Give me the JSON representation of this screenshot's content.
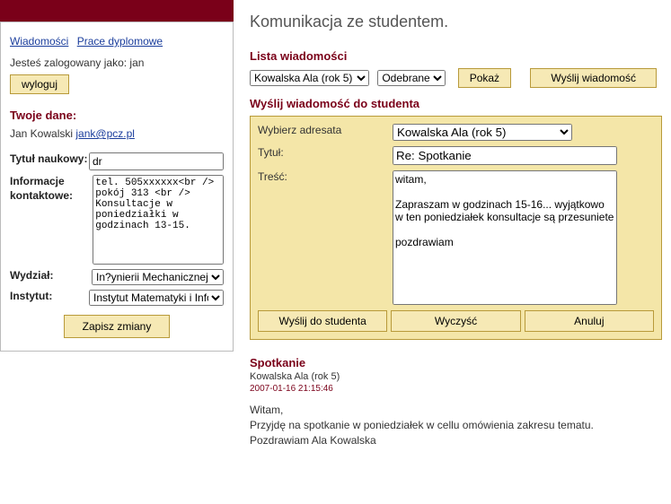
{
  "sidebar": {
    "links": {
      "wiadomosci": "Wiadomości",
      "prace": "Prace dyplomowe"
    },
    "logged_as_prefix": "Jesteś zalogowany jako: ",
    "logged_as_user": "jan",
    "logout": "wyloguj",
    "twoje_dane": "Twoje dane:",
    "name": "Jan Kowalski",
    "email": "jank@pcz.pl",
    "labels": {
      "tytul": "Tytuł naukowy:",
      "kontakt": "Informacje kontaktowe:",
      "wydzial": "Wydział:",
      "instytut": "Instytut:"
    },
    "values": {
      "tytul": "dr",
      "kontakt": "tel. 505xxxxxx<br />\npokój 313 <br />\nKonsultacje w poniedziałki w godzinach 13-15.",
      "wydzial": "In?ynierii Mechanicznej",
      "instytut": "Instytut Matematyki i Informatyki"
    },
    "save": "Zapisz zmiany"
  },
  "main": {
    "title": "Komunikacja ze studentem.",
    "lista": "Lista wiadomości",
    "filter_student": "Kowalska Ala (rok 5)",
    "filter_folder": "Odebrane",
    "pokaz": "Pokaż",
    "wyslij": "Wyślij wiadomość",
    "compose_head": "Wyślij wiadomość do studenta",
    "compose": {
      "labels": {
        "adresata": "Wybierz adresata",
        "tytul": "Tytuł:",
        "tresc": "Treść:"
      },
      "recipient": "Kowalska Ala (rok 5)",
      "title": "Re: Spotkanie",
      "body": "witam,\n\nZapraszam w godzinach 15-16... wyjątkowo w ten poniedziałek konsultacje są przesuniete\n\npozdrawiam",
      "buttons": {
        "send": "Wyślij do studenta",
        "clear": "Wyczyść",
        "cancel": "Anuluj"
      }
    },
    "message": {
      "title": "Spotkanie",
      "from": "Kowalska Ala (rok 5)",
      "date": "2007-01-16 21:15:46",
      "body": "Witam,\nPrzyjdę na spotkanie w poniedziałek w cellu omówienia zakresu tematu.\nPozdrawiam Ala Kowalska"
    }
  }
}
